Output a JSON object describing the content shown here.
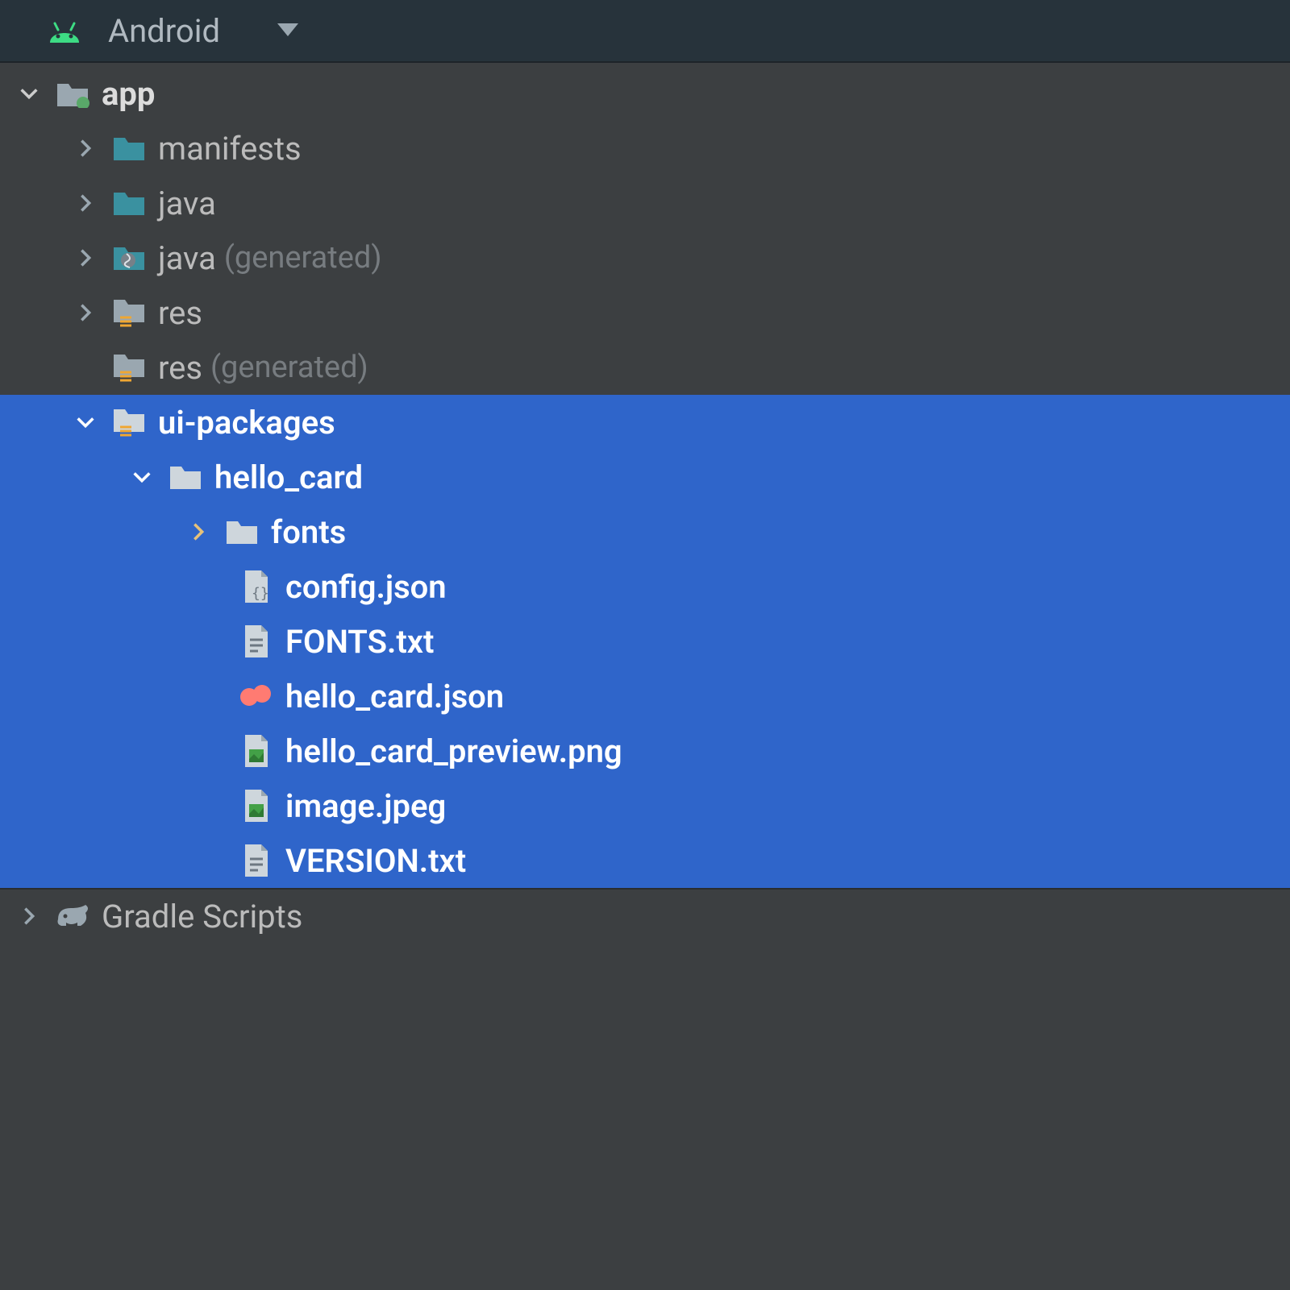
{
  "header": {
    "view_label": "Android"
  },
  "tree": {
    "app": {
      "label": "app",
      "manifests": {
        "label": "manifests"
      },
      "java": {
        "label": "java"
      },
      "java_gen": {
        "label": "java",
        "suffix": "(generated)"
      },
      "res": {
        "label": "res"
      },
      "res_gen": {
        "label": "res",
        "suffix": "(generated)"
      },
      "ui_packages": {
        "label": "ui-packages",
        "hello_card": {
          "label": "hello_card",
          "fonts": {
            "label": "fonts"
          },
          "files": {
            "config": "config.json",
            "fonts_txt": "FONTS.txt",
            "hello_card_json": "hello_card.json",
            "preview": "hello_card_preview.png",
            "image": "image.jpeg",
            "version": "VERSION.txt"
          }
        }
      }
    },
    "gradle": {
      "label": "Gradle Scripts"
    }
  },
  "colors": {
    "selection": "#2f65ca",
    "folder_teal": "#3a91a0",
    "folder_grey": "#9aa7b0",
    "accent_green": "#3ddc84",
    "accent_pink": "#ff7b72",
    "accent_yellow": "#f0a732"
  }
}
